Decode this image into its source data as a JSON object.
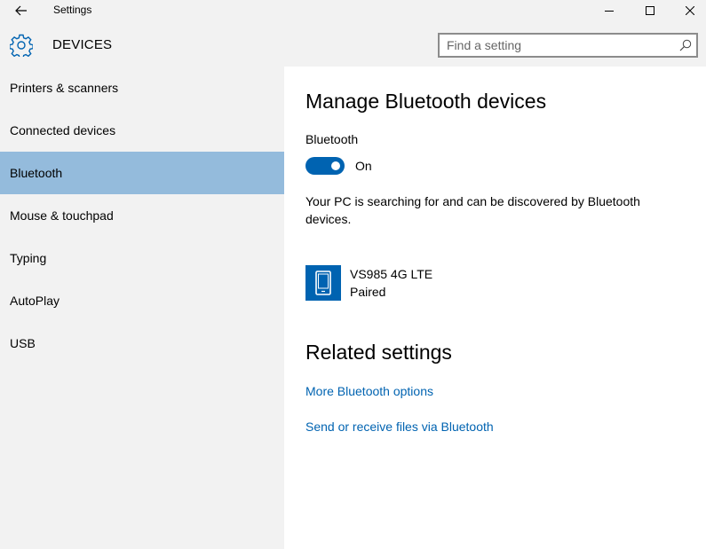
{
  "window": {
    "title": "Settings"
  },
  "header": {
    "title": "DEVICES",
    "search_placeholder": "Find a setting"
  },
  "sidebar": {
    "items": [
      {
        "label": "Printers & scanners"
      },
      {
        "label": "Connected devices"
      },
      {
        "label": "Bluetooth"
      },
      {
        "label": "Mouse & touchpad"
      },
      {
        "label": "Typing"
      },
      {
        "label": "AutoPlay"
      },
      {
        "label": "USB"
      }
    ],
    "selected": "Bluetooth"
  },
  "main": {
    "title": "Manage Bluetooth devices",
    "bluetooth_label": "Bluetooth",
    "toggle_state": "On",
    "description": "Your PC is searching for and can be discovered by Bluetooth devices.",
    "devices": [
      {
        "name": "VS985 4G LTE",
        "status": "Paired",
        "icon": "phone-icon"
      }
    ],
    "related_title": "Related settings",
    "related_links": [
      {
        "label": "More Bluetooth options"
      },
      {
        "label": "Send or receive files via Bluetooth"
      }
    ]
  },
  "colors": {
    "accent": "#0063b1",
    "selected_nav": "#94bbdc",
    "chrome_bg": "#f2f2f2",
    "content_bg": "#ffffff"
  }
}
